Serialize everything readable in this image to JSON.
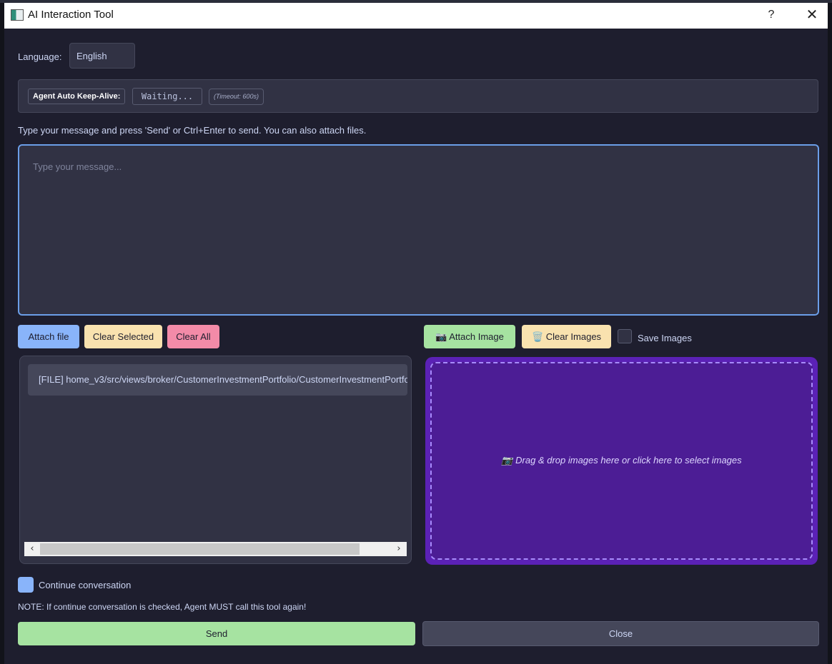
{
  "window": {
    "title": "AI Interaction Tool",
    "help_glyph": "?",
    "close_glyph": "✕"
  },
  "language": {
    "label": "Language:",
    "selected": "English"
  },
  "keepalive": {
    "label": "Agent Auto Keep-Alive:",
    "status": "Waiting...",
    "timeout": "(Timeout: 600s)"
  },
  "instructions": "Type your message and press 'Send' or Ctrl+Enter to send. You can also attach files.",
  "message": {
    "placeholder": "Type your message...",
    "value": ""
  },
  "file_buttons": {
    "attach_file": "Attach file",
    "clear_selected": "Clear Selected",
    "clear_all": "Clear All"
  },
  "image_buttons": {
    "attach_image": "📷 Attach Image",
    "clear_images": "🗑️ Clear Images",
    "save_images": "Save Images",
    "save_images_checked": false
  },
  "files": [
    {
      "text": "[FILE] home_v3/src/views/broker/CustomerInvestmentPortfolio/CustomerInvestmentPortfo"
    }
  ],
  "dropzone": {
    "text": "📷 Drag & drop images here or click here to select images"
  },
  "continue": {
    "label": "Continue conversation",
    "checked": true
  },
  "note": "NOTE: If continue conversation is checked, Agent MUST call this tool again!",
  "actions": {
    "send": "Send",
    "close": "Close"
  },
  "colors": {
    "background": "#1e1e2e",
    "panel": "#313244",
    "accent_blue": "#89b4fa",
    "accent_yellow": "#f9e2af",
    "accent_red": "#f38ba8",
    "accent_green": "#a6e3a1",
    "dropzone_purple": "#4c1d95"
  }
}
